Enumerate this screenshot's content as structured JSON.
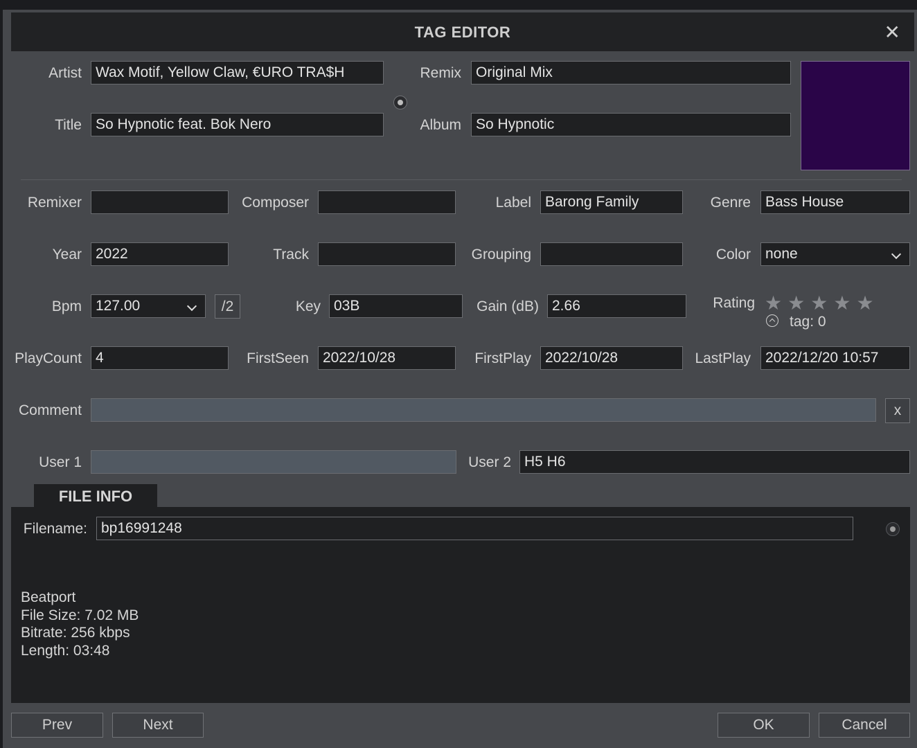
{
  "window": {
    "title": "TAG EDITOR",
    "close_glyph": "✕"
  },
  "fields": {
    "artist": {
      "label": "Artist",
      "value": "Wax Motif, Yellow Claw, €URO TRA$H"
    },
    "title": {
      "label": "Title",
      "value": "So Hypnotic feat. Bok Nero"
    },
    "remix": {
      "label": "Remix",
      "value": "Original Mix"
    },
    "album": {
      "label": "Album",
      "value": "So Hypnotic"
    },
    "remixer": {
      "label": "Remixer",
      "value": ""
    },
    "composer": {
      "label": "Composer",
      "value": ""
    },
    "label": {
      "label": "Label",
      "value": "Barong Family"
    },
    "genre": {
      "label": "Genre",
      "value": "Bass House"
    },
    "year": {
      "label": "Year",
      "value": "2022"
    },
    "track": {
      "label": "Track",
      "value": ""
    },
    "grouping": {
      "label": "Grouping",
      "value": ""
    },
    "color": {
      "label": "Color",
      "value": "none"
    },
    "bpm": {
      "label": "Bpm",
      "value": "127.00",
      "half_label": "/2"
    },
    "key": {
      "label": "Key",
      "value": "03B"
    },
    "gain": {
      "label": "Gain (dB)",
      "value": "2.66"
    },
    "rating": {
      "label": "Rating",
      "stars": 0,
      "max_stars": 5,
      "tag_text": "tag: 0"
    },
    "playcount": {
      "label": "PlayCount",
      "value": "4"
    },
    "firstseen": {
      "label": "FirstSeen",
      "value": "2022/10/28"
    },
    "firstplay": {
      "label": "FirstPlay",
      "value": "2022/10/28"
    },
    "lastplay": {
      "label": "LastPlay",
      "value": "2022/12/20 10:57"
    },
    "comment": {
      "label": "Comment",
      "value": "",
      "clear_label": "x"
    },
    "user1": {
      "label": "User 1",
      "value": ""
    },
    "user2": {
      "label": "User 2",
      "value": "H5 H6"
    }
  },
  "file_info": {
    "tab_label": "FILE INFO",
    "filename_label": "Filename:",
    "filename": "bp16991248",
    "lines": [
      "Beatport",
      "File Size: 7.02 MB",
      "Bitrate: 256 kbps",
      "Length: 03:48"
    ]
  },
  "buttons": {
    "prev": "Prev",
    "next": "Next",
    "ok": "OK",
    "cancel": "Cancel"
  },
  "colors": {
    "dialog_bg": "#46484c",
    "field_bg": "#1f2022",
    "art_bg": "#2a0548"
  }
}
